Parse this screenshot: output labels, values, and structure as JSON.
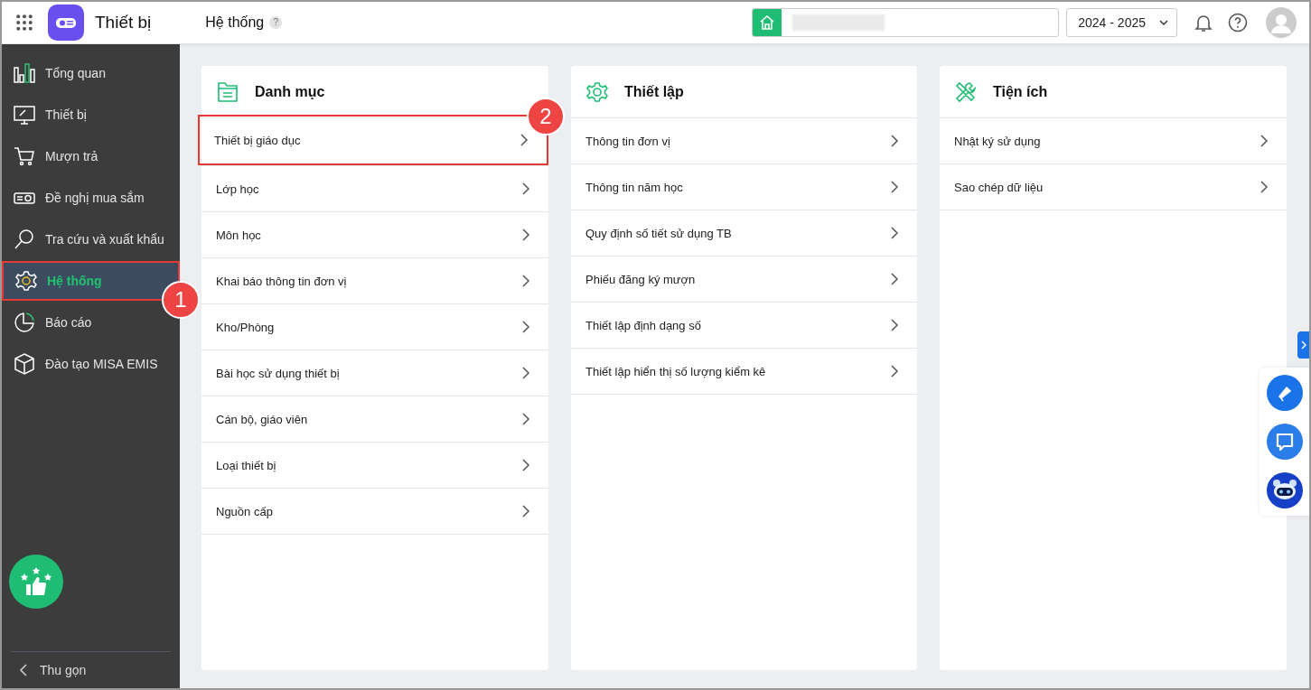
{
  "header": {
    "app_name": "Thiết bị",
    "page_title": "Hệ thống",
    "help_mark": "?",
    "school_year": "2024 - 2025"
  },
  "sidebar": {
    "items": [
      {
        "label": "Tổng quan",
        "selected": false
      },
      {
        "label": "Thiết bị",
        "selected": false
      },
      {
        "label": "Mượn trả",
        "selected": false
      },
      {
        "label": "Đề nghị mua sắm",
        "selected": false
      },
      {
        "label": "Tra cứu và xuất khẩu",
        "selected": false
      },
      {
        "label": "Hệ thống",
        "selected": true,
        "callout": "1"
      },
      {
        "label": "Báo cáo",
        "selected": false
      },
      {
        "label": "Đào tạo MISA EMIS",
        "selected": false
      }
    ],
    "collapse": "Thu gọn"
  },
  "cards": [
    {
      "title": "Danh mục",
      "items": [
        {
          "label": "Thiết bị giáo dục",
          "callout": "2"
        },
        {
          "label": "Lớp học"
        },
        {
          "label": "Môn học"
        },
        {
          "label": "Khai báo thông tin đơn vị"
        },
        {
          "label": "Kho/Phòng"
        },
        {
          "label": "Bài học sử dụng thiết bị"
        },
        {
          "label": "Cán bộ, giáo viên"
        },
        {
          "label": "Loại thiết bị"
        },
        {
          "label": "Nguồn cấp"
        }
      ]
    },
    {
      "title": "Thiết lập",
      "items": [
        {
          "label": "Thông tin đơn vị"
        },
        {
          "label": "Thông tin năm học"
        },
        {
          "label": "Quy định số tiết sử dụng TB"
        },
        {
          "label": "Phiếu đăng ký mượn"
        },
        {
          "label": "Thiết lập định dạng số"
        },
        {
          "label": "Thiết lập hiển thị số lượng kiểm kê"
        }
      ]
    },
    {
      "title": "Tiện ích",
      "items": [
        {
          "label": "Nhật ký sử dụng"
        },
        {
          "label": "Sao chép dữ liệu"
        }
      ]
    }
  ]
}
